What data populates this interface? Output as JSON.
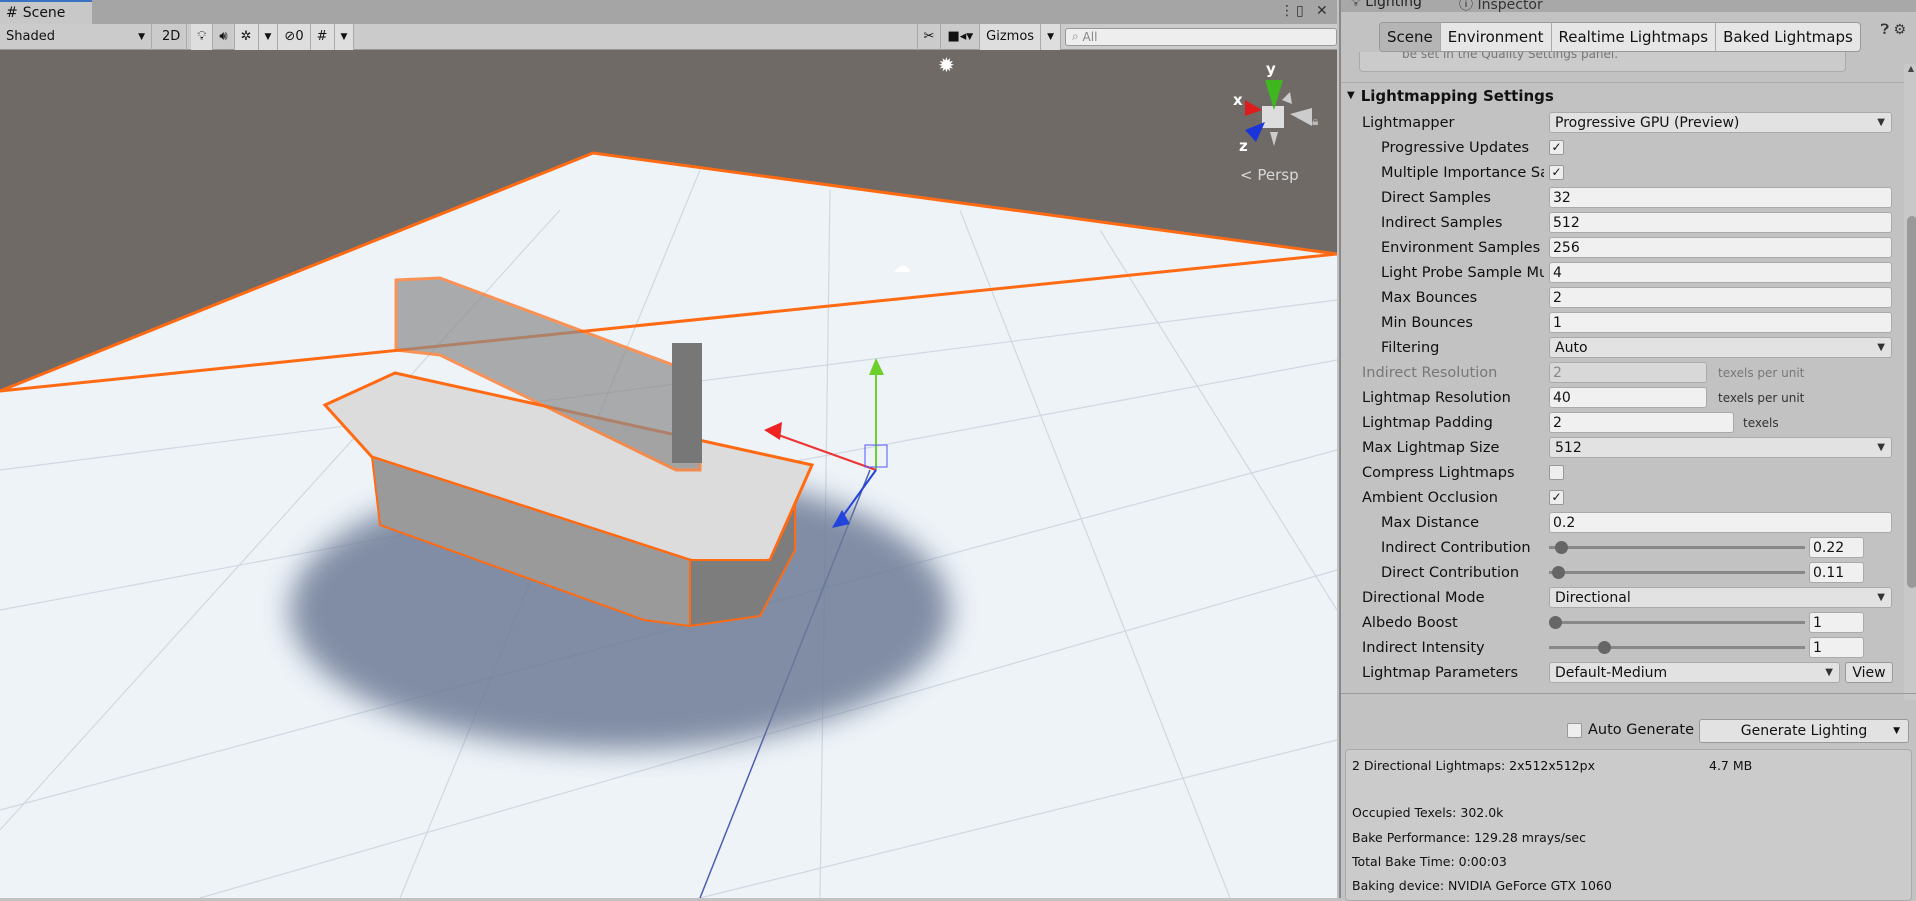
{
  "scene": {
    "tab_label": "Scene",
    "shading": "Shaded",
    "btn_2d": "2D",
    "hidden_count": "0",
    "gizmos": "Gizmos",
    "search_placeholder": "All",
    "persp": "Persp",
    "axis_labels": {
      "x": "x",
      "y": "y",
      "z": "z"
    }
  },
  "panel": {
    "tabs": [
      "Lighting",
      "Inspector"
    ],
    "subtabs": [
      "Scene",
      "Environment",
      "Realtime Lightmaps",
      "Baked Lightmaps"
    ],
    "cutoff_text": "be set in the Quality Settings panel.",
    "section_title": "Lightmapping Settings",
    "rows": {
      "lightmapper": {
        "label": "Lightmapper",
        "value": "Progressive GPU (Preview)"
      },
      "progressive_updates": {
        "label": "Progressive Updates",
        "checked": true
      },
      "mis": {
        "label": "Multiple Importance Sampling",
        "checked": true
      },
      "direct_samples": {
        "label": "Direct Samples",
        "value": "32"
      },
      "indirect_samples": {
        "label": "Indirect Samples",
        "value": "512"
      },
      "env_samples": {
        "label": "Environment Samples",
        "value": "256"
      },
      "light_probe": {
        "label": "Light Probe Sample Multiplier",
        "value": "4"
      },
      "max_bounces": {
        "label": "Max Bounces",
        "value": "2"
      },
      "min_bounces": {
        "label": "Min Bounces",
        "value": "1"
      },
      "filtering": {
        "label": "Filtering",
        "value": "Auto"
      },
      "indirect_res": {
        "label": "Indirect Resolution",
        "value": "2",
        "unit": "texels per unit"
      },
      "lightmap_res": {
        "label": "Lightmap Resolution",
        "value": "40",
        "unit": "texels per unit"
      },
      "padding": {
        "label": "Lightmap Padding",
        "value": "2",
        "unit": "texels"
      },
      "max_size": {
        "label": "Max Lightmap Size",
        "value": "512"
      },
      "compress": {
        "label": "Compress Lightmaps",
        "checked": false
      },
      "ao": {
        "label": "Ambient Occlusion",
        "checked": true
      },
      "max_distance": {
        "label": "Max Distance",
        "value": "0.2"
      },
      "indirect_contrib": {
        "label": "Indirect Contribution",
        "value": "0.22",
        "fraction": 0.022
      },
      "direct_contrib": {
        "label": "Direct Contribution",
        "value": "0.11",
        "fraction": 0.011
      },
      "dir_mode": {
        "label": "Directional Mode",
        "value": "Directional"
      },
      "albedo": {
        "label": "Albedo Boost",
        "value": "1",
        "fraction": 0.0
      },
      "indirect_intensity": {
        "label": "Indirect Intensity",
        "value": "1",
        "fraction": 0.2
      },
      "params": {
        "label": "Lightmap Parameters",
        "value": "Default-Medium",
        "button": "View"
      }
    },
    "auto_generate": {
      "label": "Auto Generate",
      "checked": false
    },
    "generate_button": "Generate Lighting",
    "info": {
      "lightmaps": "2 Directional Lightmaps: 2x512x512px",
      "size": "4.7 MB",
      "texels": "Occupied Texels: 302.0k",
      "performance": "Bake Performance: 129.28 mrays/sec",
      "time": "Total Bake Time: 0:00:03",
      "device": "Baking device: NVIDIA GeForce GTX 1060"
    }
  },
  "colors": {
    "selection": "#ff6a13",
    "tab_accent": "#3a72c4"
  }
}
